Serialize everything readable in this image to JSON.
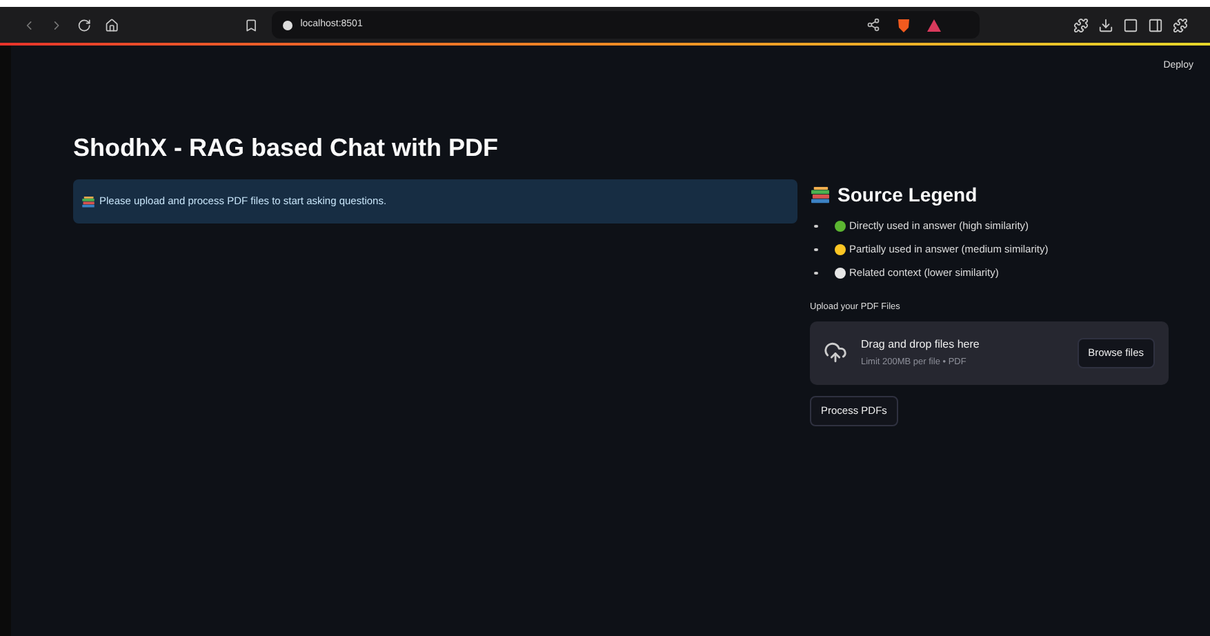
{
  "browser": {
    "url": "localhost:8501"
  },
  "header": {
    "deploy": "Deploy"
  },
  "main": {
    "title": "ShodhX - RAG based Chat with PDF",
    "info": "Please upload and process PDF files to start asking questions."
  },
  "legend": {
    "title": "Source Legend",
    "items": [
      {
        "label": "Directly used in answer (high similarity)",
        "color": "#5cb531"
      },
      {
        "label": "Partially used in answer (medium similarity)",
        "color": "#fcc624"
      },
      {
        "label": "Related context (lower similarity)",
        "color": "#e6e6e6"
      }
    ]
  },
  "uploader": {
    "label": "Upload your PDF Files",
    "drop_text": "Drag and drop files here",
    "limit": "Limit 200MB per file • PDF",
    "browse": "Browse files"
  },
  "process_button": "Process PDFs"
}
